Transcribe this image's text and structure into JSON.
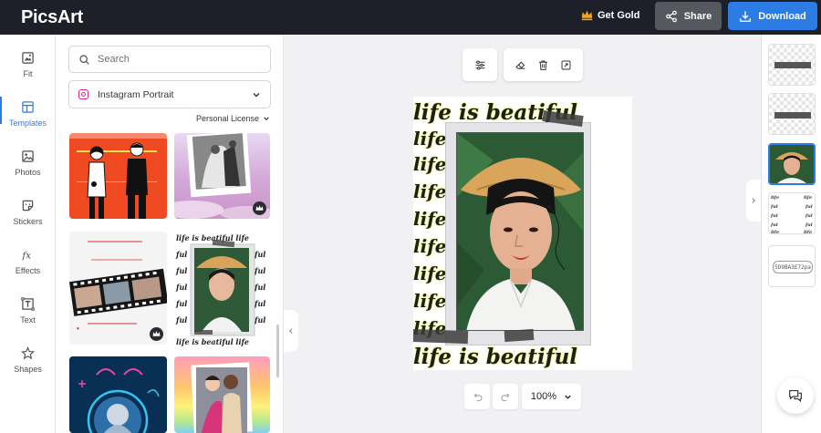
{
  "header": {
    "logo": "PicsArt",
    "get_gold_label": "Get Gold",
    "share_label": "Share",
    "download_label": "Download",
    "gold_color": "#f5a623",
    "accent_color": "#2d7be5"
  },
  "leftnav": {
    "items": [
      {
        "label": "Fit",
        "icon": "fit-icon"
      },
      {
        "label": "Templates",
        "icon": "templates-icon",
        "active": true
      },
      {
        "label": "Photos",
        "icon": "photos-icon"
      },
      {
        "label": "Stickers",
        "icon": "stickers-icon"
      },
      {
        "label": "Effects",
        "icon": "effects-icon"
      },
      {
        "label": "Text",
        "icon": "text-icon"
      },
      {
        "label": "Shapes",
        "icon": "shapes-icon"
      }
    ]
  },
  "panel": {
    "search_placeholder": "Search",
    "format_label": "Instagram Portrait",
    "license_label": "Personal License",
    "templates": [
      {
        "name": "couple-illustration",
        "premium": false
      },
      {
        "name": "wedding-photo",
        "premium": true
      },
      {
        "name": "film-strip-birthday",
        "premium": true
      },
      {
        "name": "life-is-beautiful",
        "premium": false
      },
      {
        "name": "zodiac-neon",
        "premium": false
      },
      {
        "name": "rainbow-friends",
        "premium": false
      }
    ]
  },
  "canvas": {
    "script_text": "life is beatiful",
    "zoom_label": "100%"
  },
  "layers": {
    "hex_label": "5D9BA3E72pa"
  }
}
